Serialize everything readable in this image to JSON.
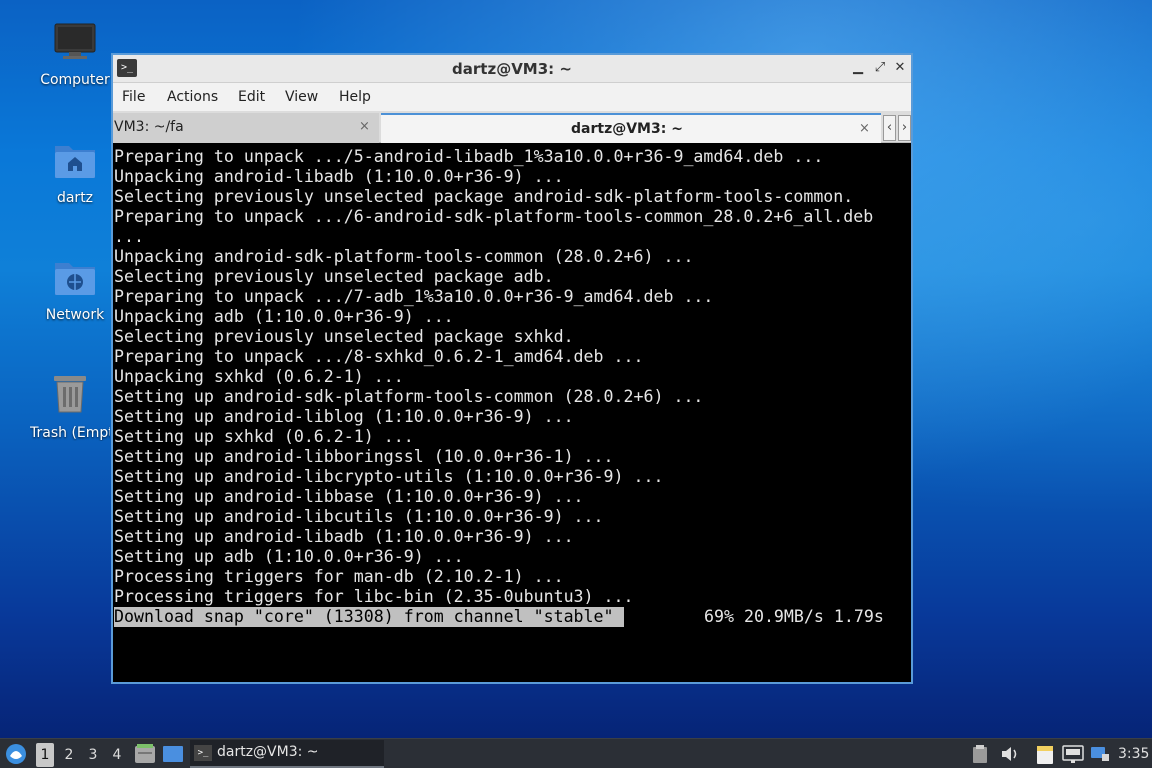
{
  "desktop": {
    "icons": [
      {
        "name": "computer",
        "label": "Computer"
      },
      {
        "name": "home",
        "label": "dartz"
      },
      {
        "name": "network",
        "label": "Network"
      },
      {
        "name": "trash",
        "label": "Trash (Empty)"
      }
    ]
  },
  "window": {
    "title": "dartz@VM3: ~",
    "menu": [
      "File",
      "Actions",
      "Edit",
      "View",
      "Help"
    ],
    "tabs": [
      {
        "label": "VM3: ~/fa",
        "close": "×"
      },
      {
        "label": "dartz@VM3: ~",
        "close": "×"
      }
    ],
    "tab_scroll_left": "‹",
    "tab_scroll_right": "›",
    "controls": {
      "minimize": "▁",
      "maximize": "⤢",
      "close": "✕"
    }
  },
  "terminal": {
    "lines": [
      "Preparing to unpack .../5-android-libadb_1%3a10.0.0+r36-9_amd64.deb ...",
      "Unpacking android-libadb (1:10.0.0+r36-9) ...",
      "Selecting previously unselected package android-sdk-platform-tools-common.",
      "Preparing to unpack .../6-android-sdk-platform-tools-common_28.0.2+6_all.deb",
      "...",
      "Unpacking android-sdk-platform-tools-common (28.0.2+6) ...",
      "Selecting previously unselected package adb.",
      "Preparing to unpack .../7-adb_1%3a10.0.0+r36-9_amd64.deb ...",
      "Unpacking adb (1:10.0.0+r36-9) ...",
      "Selecting previously unselected package sxhkd.",
      "Preparing to unpack .../8-sxhkd_0.6.2-1_amd64.deb ...",
      "Unpacking sxhkd (0.6.2-1) ...",
      "Setting up android-sdk-platform-tools-common (28.0.2+6) ...",
      "Setting up android-liblog (1:10.0.0+r36-9) ...",
      "Setting up sxhkd (0.6.2-1) ...",
      "Setting up android-libboringssl (10.0.0+r36-1) ...",
      "Setting up android-libcrypto-utils (1:10.0.0+r36-9) ...",
      "Setting up android-libbase (1:10.0.0+r36-9) ...",
      "Setting up android-libcutils (1:10.0.0+r36-9) ...",
      "Setting up android-libadb (1:10.0.0+r36-9) ...",
      "Setting up adb (1:10.0.0+r36-9) ...",
      "Processing triggers for man-db (2.10.2-1) ...",
      "Processing triggers for libc-bin (2.35-0ubuntu3) ..."
    ],
    "progress_line": "Download snap \"core\" (13308) from channel \"stable\" ",
    "progress_stats": "69% 20.9MB/s 1.79s"
  },
  "taskbar": {
    "workspaces": [
      "1",
      "2",
      "3",
      "4"
    ],
    "active_workspace": "1",
    "task_label": "dartz@VM3: ~",
    "clock": "3:35"
  },
  "colors": {
    "window_border": "#5a9bd8",
    "terminal_bg": "#000000",
    "terminal_fg": "#e6e6e6",
    "highlight_bg": "#c0c0c0",
    "taskbar_bg": "#2b2f36"
  }
}
